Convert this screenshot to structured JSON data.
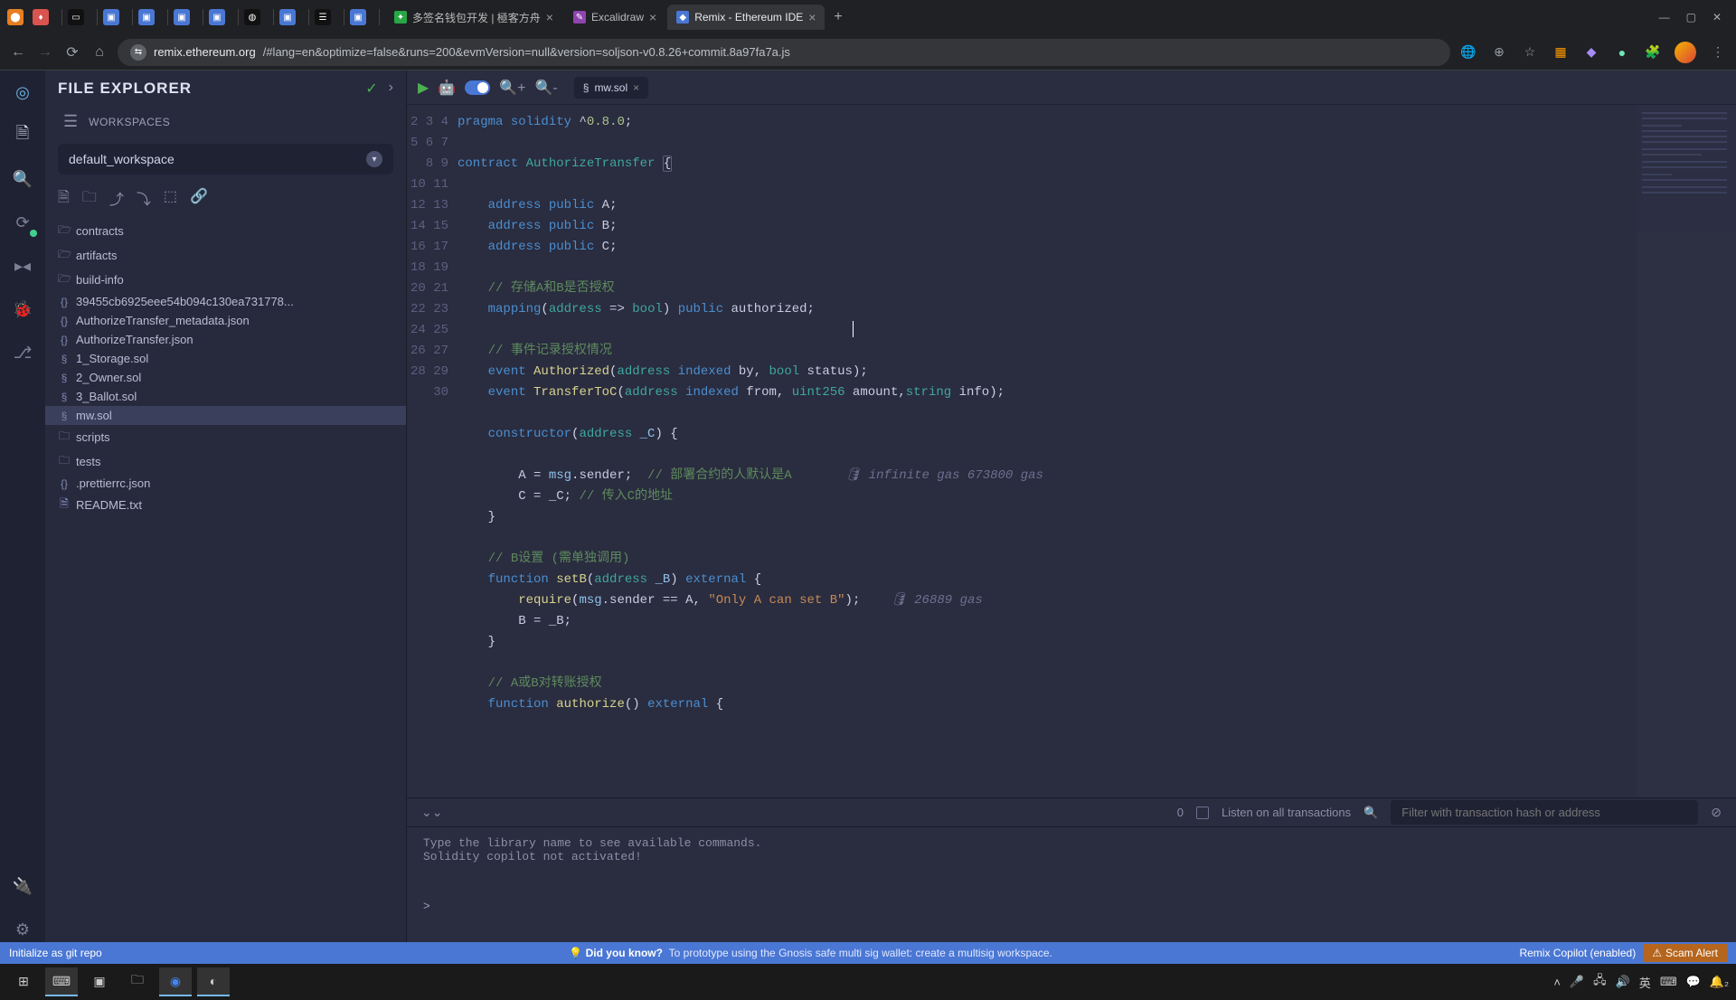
{
  "browser": {
    "tabs": [
      {
        "title": "多签名钱包开发 | 極客方舟",
        "favicon": "green"
      },
      {
        "title": "Excalidraw",
        "favicon": "purple"
      },
      {
        "title": "Remix - Ethereum IDE",
        "favicon": "blue",
        "active": true
      }
    ],
    "url_host": "remix.ethereum.org",
    "url_path": "/#lang=en&optimize=false&runs=200&evmVersion=null&version=soljson-v0.8.26+commit.8a97fa7a.js"
  },
  "ide": {
    "file_explorer_title": "FILE EXPLORER",
    "workspaces_label": "WORKSPACES",
    "workspace_selected": "default_workspace",
    "tree": {
      "contracts": "contracts",
      "artifacts": "artifacts",
      "build_info": "build-info",
      "build_info_file": "39455cb6925eee54b094c130ea731778...",
      "meta_json": "AuthorizeTransfer_metadata.json",
      "abi_json": "AuthorizeTransfer.json",
      "storage": "1_Storage.sol",
      "owner": "2_Owner.sol",
      "ballot": "3_Ballot.sol",
      "mw": "mw.sol",
      "scripts": "scripts",
      "tests": "tests",
      "prettier": ".prettierrc.json",
      "readme": "README.txt"
    },
    "editor_tab": "mw.sol",
    "gas_constructor": "infinite gas 673800 gas",
    "gas_setb": "26889 gas",
    "code": {
      "l2": "pragma solidity ^0.8.0;",
      "l4_contract": "contract",
      "l4_name": "AuthorizeTransfer",
      "l6": "address public A;",
      "l7": "address public B;",
      "l8": "address public C;",
      "l10_cmt": "// 存储A和B是否授权",
      "l11_a": "mapping",
      "l11_b": "address",
      "l11_c": "bool",
      "l11_d": "public",
      "l11_e": "authorized;",
      "l13_cmt": "// 事件记录授权情况",
      "l14_a": "event",
      "l14_b": "Authorized(",
      "l14_c": "address",
      "l14_d": "indexed",
      "l14_e": "by,",
      "l14_f": "bool",
      "l14_g": "status);",
      "l15_a": "event",
      "l15_b": "TransferToC(",
      "l15_c": "address",
      "l15_d": "indexed",
      "l15_e": "from,",
      "l15_f": "uint256",
      "l15_g": "amount,",
      "l15_h": "string",
      "l15_i": "info);",
      "l17_a": "constructor",
      "l17_b": "address",
      "l17_c": "_C",
      "l19_a": "A =",
      "l19_b": "msg",
      "l19_c": ".sender;",
      "l19_cmt": "// 部署合约的人默认是A",
      "l20_a": "C = _C;",
      "l20_cmt": "// 传入C的地址",
      "l23_cmt": "// B设置 (需单独调用)",
      "l24_a": "function",
      "l24_b": "setB(",
      "l24_c": "address",
      "l24_d": "_B)",
      "l24_e": "external",
      "l25_a": "require",
      "l25_b": "msg",
      "l25_c": ".sender == A,",
      "l25_d": "\"Only A can set B\"",
      "l25_e": ");",
      "l26": "B = _B;",
      "l29_cmt": "// A或B对转账授权",
      "l30_a": "function",
      "l30_b": "authorize()",
      "l30_c": "external"
    },
    "terminal": {
      "pending_count": "0",
      "listen_label": "Listen on all transactions",
      "filter_placeholder": "Filter with transaction hash or address",
      "msg1": "Type the library name to see available commands.",
      "msg2": "Solidity copilot not activated!",
      "prompt": ">"
    },
    "status": {
      "git": "Initialize as git repo",
      "tip_title": "Did you know?",
      "tip_body": "To prototype using the Gnosis safe multi sig wallet: create a multisig workspace.",
      "copilot": "Remix Copilot (enabled)",
      "scam": "Scam Alert"
    }
  },
  "taskbar": {
    "lang": "英",
    "ime": "⌨"
  }
}
